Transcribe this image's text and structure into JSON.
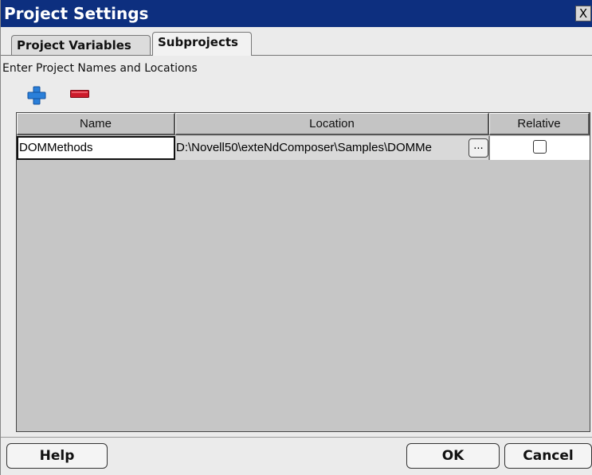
{
  "window": {
    "title": "Project Settings",
    "close_label": "X"
  },
  "tabs": [
    {
      "label": "Project Variables",
      "active": false
    },
    {
      "label": "Subprojects",
      "active": true
    }
  ],
  "instruction": "Enter Project Names and Locations",
  "toolbar": {
    "add_icon": "plus-icon",
    "remove_icon": "minus-icon"
  },
  "table": {
    "headers": [
      "Name",
      "Location",
      "Relative"
    ],
    "rows": [
      {
        "name": "DOMMethods",
        "location": "D:\\Novell50\\exteNdComposer\\Samples\\DOMMe",
        "browse": "...",
        "relative": false
      }
    ]
  },
  "buttons": {
    "help": "Help",
    "ok": "OK",
    "cancel": "Cancel"
  },
  "colors": {
    "titlebar": "#0d2f7f",
    "add_icon": "#2a7fd9",
    "remove_icon": "#cc1b2b"
  }
}
